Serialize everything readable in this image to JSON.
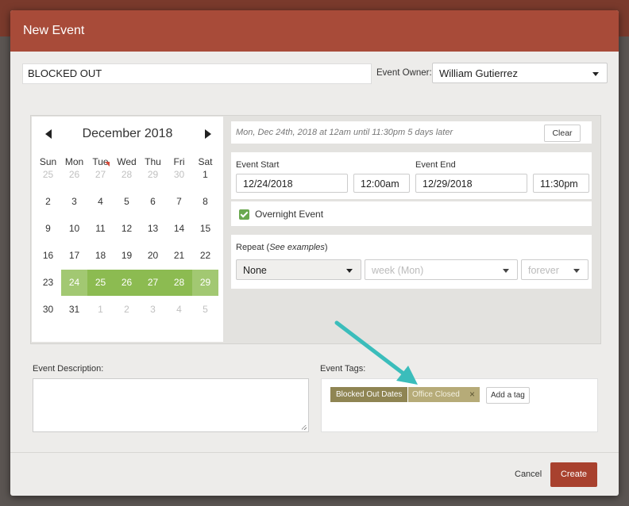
{
  "modal": {
    "title": "New Event"
  },
  "event": {
    "title_value": "BLOCKED OUT",
    "owner_label": "Event Owner:",
    "owner_value": "William Gutierrez"
  },
  "calendar": {
    "month_label": "December 2018",
    "weekdays": [
      "Sun",
      "Mon",
      "Tue",
      "Wed",
      "Thu",
      "Fri",
      "Sat"
    ],
    "weeks": [
      [
        "25",
        "26",
        "27",
        "28",
        "29",
        "30",
        "1"
      ],
      [
        "2",
        "3",
        "4",
        "5",
        "6",
        "7",
        "8"
      ],
      [
        "9",
        "10",
        "11",
        "12",
        "13",
        "14",
        "15"
      ],
      [
        "16",
        "17",
        "18",
        "19",
        "20",
        "21",
        "22"
      ],
      [
        "23",
        "24",
        "25",
        "26",
        "27",
        "28",
        "29"
      ],
      [
        "30",
        "31",
        "1",
        "2",
        "3",
        "4",
        "5"
      ]
    ],
    "selected_range": [
      "24",
      "25",
      "26",
      "27",
      "28",
      "29"
    ],
    "today_marker": "27",
    "highlight_color": "#8cbb51"
  },
  "summary": {
    "text": "Mon, Dec 24th, 2018 at 12am until 11:30pm 5 days later",
    "clear_label": "Clear"
  },
  "dates": {
    "start_label": "Event Start",
    "start_date": "12/24/2018",
    "start_time": "12:00am",
    "end_label": "Event End",
    "end_date": "12/29/2018",
    "end_time": "11:30pm"
  },
  "overnight": {
    "label": "Overnight Event",
    "checked": true
  },
  "repeat": {
    "label": "Repeat (",
    "examples_link": "See examples",
    "label_close": ")",
    "frequency": "None",
    "interval": "week (Mon)",
    "duration": "forever"
  },
  "description": {
    "label": "Event Description:",
    "value": ""
  },
  "tags": {
    "label": "Event Tags:",
    "items": [
      "Blocked Out Dates",
      "Office Closed"
    ],
    "remove_icon": "×",
    "add_label": "Add a tag"
  },
  "footer": {
    "cancel_label": "Cancel",
    "create_label": "Create"
  },
  "colors": {
    "header": "#a84b39",
    "create_button": "#a8412e",
    "tag_primary": "#8f8553",
    "tag_secondary": "#b6ab78",
    "annotation_arrow": "#3bbdbb"
  }
}
